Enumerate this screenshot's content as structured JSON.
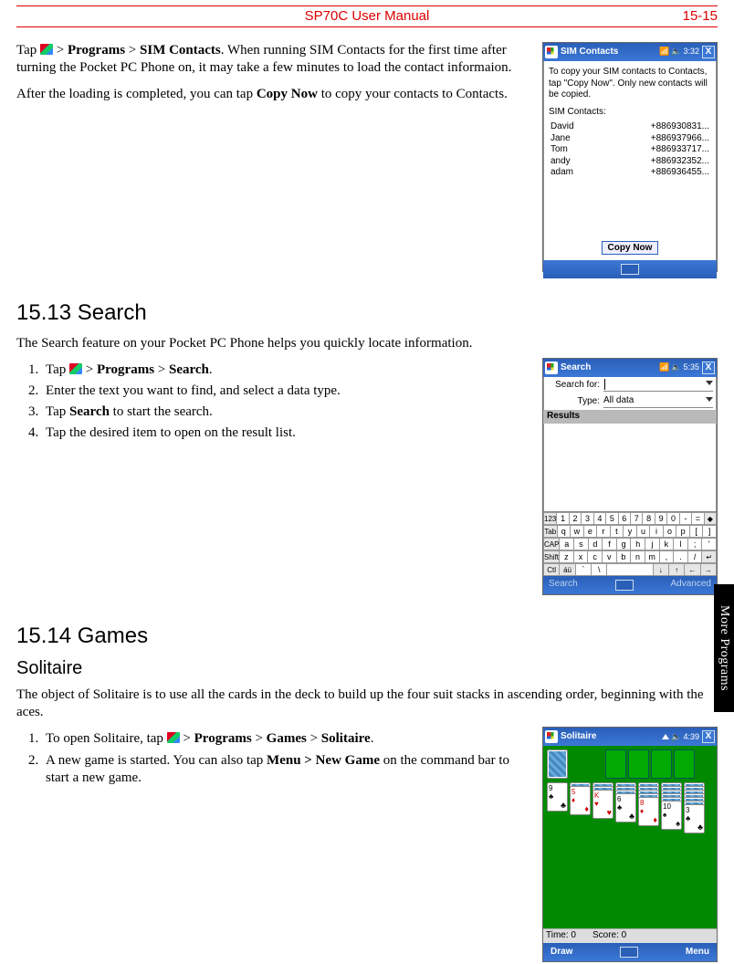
{
  "header": {
    "center": "SP70C User Manual",
    "right": "15-15"
  },
  "side_tab": "More Programs",
  "sim_contacts": {
    "intro_pre": "Tap ",
    "intro_post": " > ",
    "b1": "Programs",
    "b2": "SIM Contacts",
    "intro_rest": ". When running SIM Contacts for the first time after turning the Pocket PC Phone on, it may take a few minutes to load the contact informaion.",
    "p2_pre": "After the loading is completed, you can tap ",
    "p2_bold": "Copy Now",
    "p2_post": " to copy your contacts to Contacts.",
    "win": {
      "title": "SIM Contacts",
      "time": "3:32",
      "close": "X",
      "hint": "To copy your SIM contacts to Contacts, tap \"Copy Now\". Only new contacts will be copied.",
      "label": "SIM Contacts:",
      "rows": [
        {
          "name": "David",
          "num": "+886930831..."
        },
        {
          "name": "Jane",
          "num": "+886937966..."
        },
        {
          "name": "Tom",
          "num": "+886933717..."
        },
        {
          "name": "andy",
          "num": "+886932352..."
        },
        {
          "name": "adam",
          "num": "+886936455..."
        }
      ],
      "copy_btn": "Copy Now"
    }
  },
  "search": {
    "heading": "15.13  Search",
    "intro": "The Search feature on your Pocket PC Phone helps you quickly locate information.",
    "steps": {
      "s1_pre": "Tap ",
      "s1_post": " > ",
      "s1_b1": "Programs",
      "s1_b2": "Search",
      "s1_end": ".",
      "s2": "Enter the text you want to find, and select a data type.",
      "s3_pre": "Tap ",
      "s3_b": "Search",
      "s3_post": " to start the search.",
      "s4": "Tap the desired item to open on the result list."
    },
    "win": {
      "title": "Search",
      "time": "5:35",
      "close": "X",
      "lbl_for": "Search for:",
      "lbl_type": "Type:",
      "type_val": "All data",
      "results": "Results",
      "kbd": {
        "r1": [
          "123",
          "1",
          "2",
          "3",
          "4",
          "5",
          "6",
          "7",
          "8",
          "9",
          "0",
          "-",
          "=",
          "◆"
        ],
        "r2": [
          "Tab",
          "q",
          "w",
          "e",
          "r",
          "t",
          "y",
          "u",
          "i",
          "o",
          "p",
          "[",
          "]"
        ],
        "r3": [
          "CAP",
          "a",
          "s",
          "d",
          "f",
          "g",
          "h",
          "j",
          "k",
          "l",
          ";",
          "'"
        ],
        "r4": [
          "Shift",
          "z",
          "x",
          "c",
          "v",
          "b",
          "n",
          "m",
          ",",
          ".",
          "/",
          "↵"
        ],
        "r5": [
          "Ctl",
          "áü",
          "`",
          "\\",
          " ",
          "↓",
          "↑",
          "←",
          "→"
        ]
      },
      "bottom_left": "Search",
      "bottom_right": "Advanced"
    }
  },
  "games": {
    "heading": "15.14  Games",
    "sub": "Solitaire",
    "intro": "The object of Solitaire is to use all the cards in the deck to build up the four suit stacks in ascending order, beginning with the aces.",
    "steps": {
      "s1_pre": "To open Solitaire, tap ",
      "s1_post": " > ",
      "s1_b1": "Programs",
      "s1_b2": "Games",
      "s1_b3": "Solitaire",
      "s1_end": ".",
      "s2_pre": "A new game is started. You can also tap ",
      "s2_b": "Menu > New Game",
      "s2_post": " on the command bar to start a new game."
    },
    "win": {
      "title": "Solitaire",
      "time": "4:39",
      "close": "X",
      "status_time_lbl": "Time: ",
      "status_time_val": "0",
      "status_score_lbl": "Score: ",
      "status_score_val": "0",
      "bottom_left": "Draw",
      "bottom_right": "Menu",
      "cols": [
        {
          "face": "9",
          "suit": "♣",
          "color": "blk",
          "backs": 0
        },
        {
          "face": "5",
          "suit": "♦",
          "color": "red",
          "backs": 1
        },
        {
          "face": "K",
          "suit": "♥",
          "color": "red",
          "backs": 2
        },
        {
          "face": "6",
          "suit": "♣",
          "color": "blk",
          "backs": 3
        },
        {
          "face": "8",
          "suit": "♦",
          "color": "red",
          "backs": 4
        },
        {
          "face": "10",
          "suit": "♠",
          "color": "blk",
          "backs": 5
        },
        {
          "face": "3",
          "suit": "♣",
          "color": "blk",
          "backs": 6
        }
      ]
    }
  }
}
